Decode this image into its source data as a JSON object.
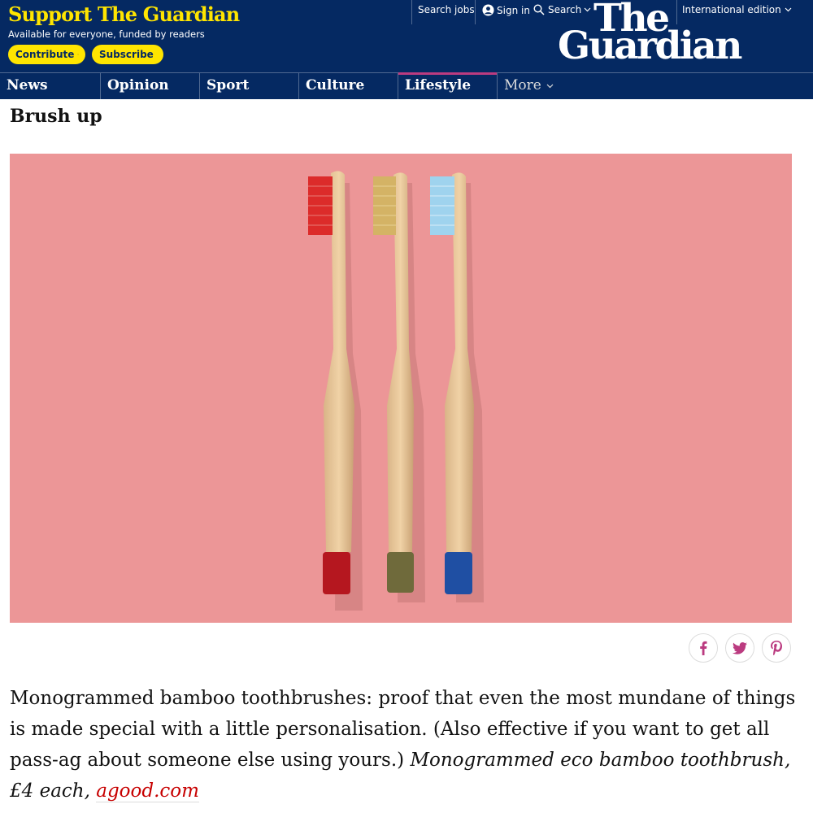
{
  "header": {
    "support_title": "Support The Guardian",
    "support_subtitle": "Available for everyone, funded by readers",
    "contribute_label": "Contribute",
    "subscribe_label": "Subscribe",
    "search_jobs": "Search jobs",
    "sign_in": "Sign in",
    "search": "Search",
    "edition": "International edition",
    "logo_line1": "The",
    "logo_line2": "Guardian"
  },
  "nav": {
    "items": [
      {
        "label": "News"
      },
      {
        "label": "Opinion"
      },
      {
        "label": "Sport"
      },
      {
        "label": "Culture"
      },
      {
        "label": "Lifestyle",
        "active": true
      },
      {
        "label": "More"
      }
    ]
  },
  "article": {
    "headline": "Brush up",
    "body": "Monogrammed bamboo toothbrushes: proof that even the most mundane of things is made special with a little personalisation. (Also effective if you want to get all pass-ag about someone else using yours.)",
    "product_caption": "Monogrammed eco bamboo toothbrush, £4 each,",
    "link_text": "agood.com"
  },
  "share": [
    "facebook-icon",
    "twitter-icon",
    "pinterest-icon"
  ],
  "colors": {
    "brand_blue": "#052962",
    "brand_yellow": "#ffe500",
    "lifestyle_accent": "#bb3b80",
    "hero_background": "#ec9697",
    "link_red": "#c70000"
  }
}
